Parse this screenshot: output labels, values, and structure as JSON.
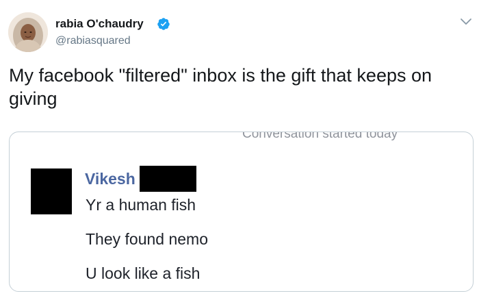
{
  "tweet": {
    "author": {
      "display_name": "rabia O'chaudry",
      "handle": "@rabiasquared",
      "verified": true,
      "avatar_icon": "profile-photo"
    },
    "text": "My facebook \"filtered\" inbox is the gift that keeps on giving",
    "menu_icon": "chevron-down-icon"
  },
  "screenshot": {
    "conversation_status": "Conversation started today",
    "sender_name": "Vikesh",
    "messages": [
      "Yr a human fish",
      "They found nemo",
      "U look like a fish"
    ]
  },
  "colors": {
    "text": "#14171a",
    "secondary_text": "#657786",
    "verified_badge": "#1da1f2",
    "messenger_name": "#4b67a1",
    "border": "#c4cfd6"
  }
}
